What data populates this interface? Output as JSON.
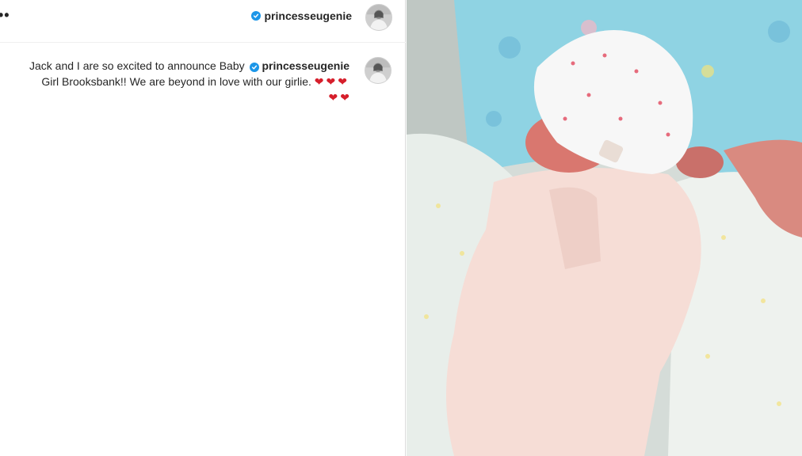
{
  "header": {
    "more_label": "••",
    "username": "princesseugenie",
    "verified_icon": "verified-badge-icon"
  },
  "caption": {
    "line1_text": "Jack and I are so excited to announce Baby",
    "username": "princesseugenie",
    "line2_text": "Girl Brooksbank!! We are beyond in love with our girlie.",
    "hearts_row1": "❤❤❤",
    "hearts_row2": "❤❤"
  },
  "photo": {
    "icon": "newborn-baby-photo"
  },
  "colors": {
    "verified": "#1c96e8",
    "heart": "#d61e2b",
    "text": "#262626"
  }
}
